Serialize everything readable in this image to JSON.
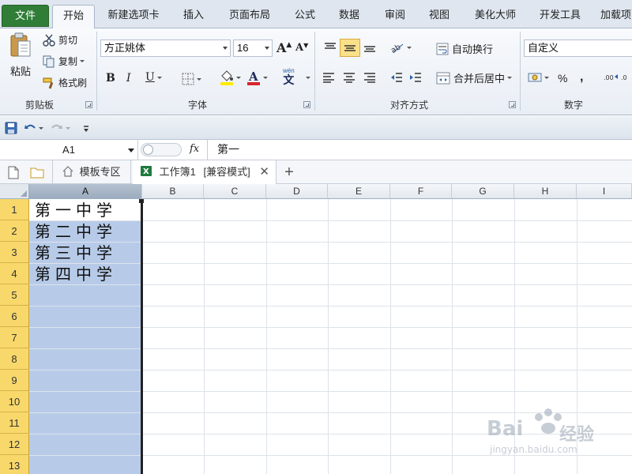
{
  "ribbon_tabs": [
    "文件",
    "开始",
    "新建选项卡",
    "插入",
    "页面布局",
    "公式",
    "数据",
    "审阅",
    "视图",
    "美化大师",
    "开发工具",
    "加载项"
  ],
  "clipboard": {
    "paste": "粘贴",
    "cut": "剪切",
    "copy": "复制",
    "format_painter": "格式刷",
    "label": "剪贴板"
  },
  "font": {
    "name": "方正姚体",
    "size": "16",
    "grow": "A",
    "shrink": "A",
    "bold": "B",
    "italic": "I",
    "underline": "U",
    "wen": "wén",
    "wen_char": "文",
    "label": "字体",
    "font_color": "#d9262b",
    "highlight_color": "#ffea00"
  },
  "alignment": {
    "wrap": "自动换行",
    "merge": "合并后居中",
    "label": "对齐方式"
  },
  "number": {
    "format": "自定义",
    "percent": "%",
    "comma": ",",
    "label": "数字"
  },
  "formula_bar": {
    "name_box": "A1",
    "fx": "fx",
    "content": "第一"
  },
  "doc_tabs": {
    "template": "模板专区",
    "workbook": "工作簿1",
    "mode": "[兼容模式]",
    "add": "+"
  },
  "columns": [
    "A",
    "B",
    "C",
    "D",
    "E",
    "F",
    "G",
    "H",
    "I"
  ],
  "rows": [
    "1",
    "2",
    "3",
    "4",
    "5",
    "6",
    "7",
    "8",
    "9",
    "10",
    "11",
    "12",
    "13"
  ],
  "cells_A": [
    "第一中学",
    "第二中学",
    "第三中学",
    "第四中学"
  ],
  "watermark": {
    "brand": "Bai",
    "brand2": "经验",
    "url": "jingyan.baidu.com"
  },
  "colors": {
    "file_tab": "#2f7d37",
    "row_header": "#f8d86b",
    "selection": "#b7cbe9"
  }
}
